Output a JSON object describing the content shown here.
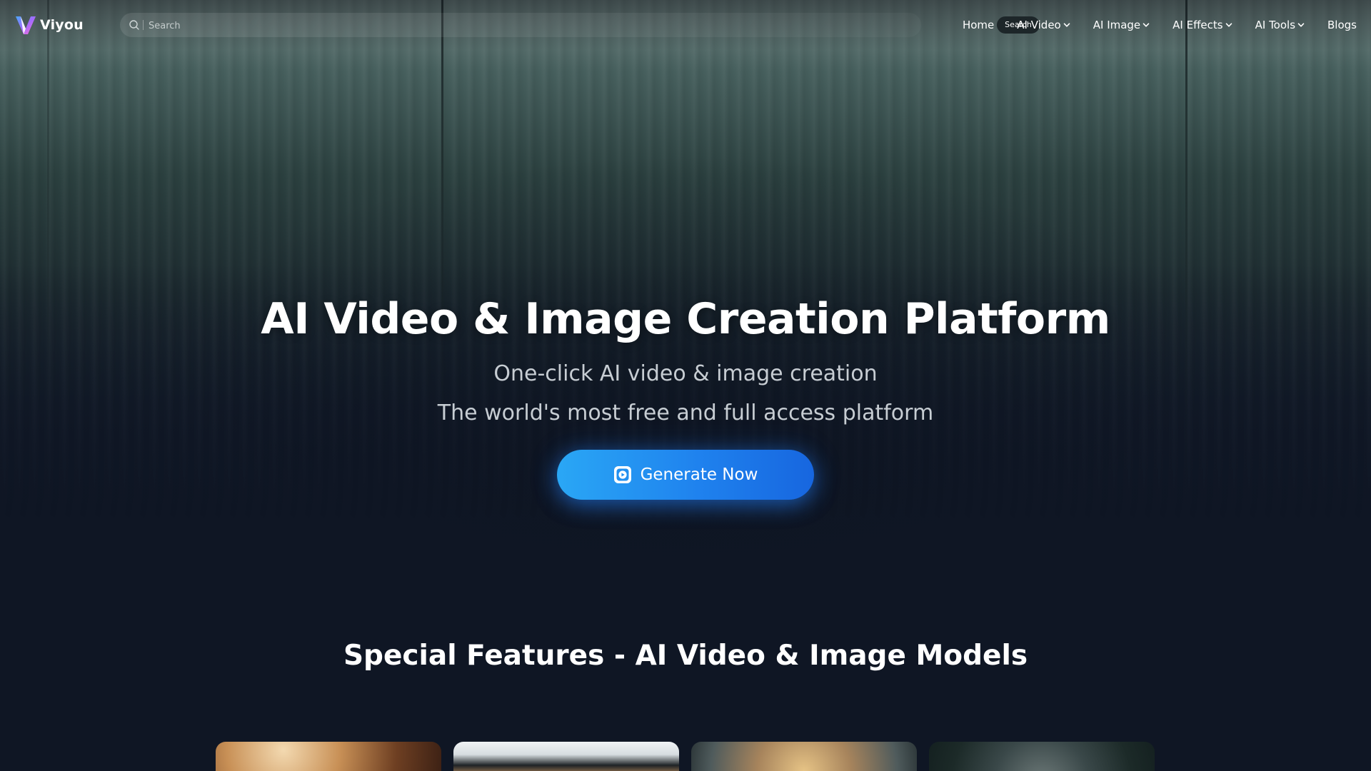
{
  "header": {
    "brand": "Viyou",
    "search": {
      "placeholder": "Search",
      "button_label": "Search"
    },
    "nav": [
      {
        "label": "Home",
        "has_dropdown": false
      },
      {
        "label": "AI Video",
        "has_dropdown": true
      },
      {
        "label": "AI Image",
        "has_dropdown": true
      },
      {
        "label": "AI Effects",
        "has_dropdown": true
      },
      {
        "label": "AI Tools",
        "has_dropdown": true
      },
      {
        "label": "Blogs",
        "has_dropdown": false
      }
    ]
  },
  "hero": {
    "title": "AI Video & Image Creation Platform",
    "subtitle_line1": "One-click AI video & image creation",
    "subtitle_line2": "The world's most free and full access platform",
    "cta_label": "Generate Now",
    "cta_icon": "play-icon"
  },
  "features": {
    "title": "Special Features - AI Video & Image Models"
  },
  "colors": {
    "accent": "#1f82ee",
    "accent_light": "#2aa7f5",
    "background": "#0f1624",
    "text": "#ffffff",
    "subtitle_text": "#c7cdd3"
  }
}
